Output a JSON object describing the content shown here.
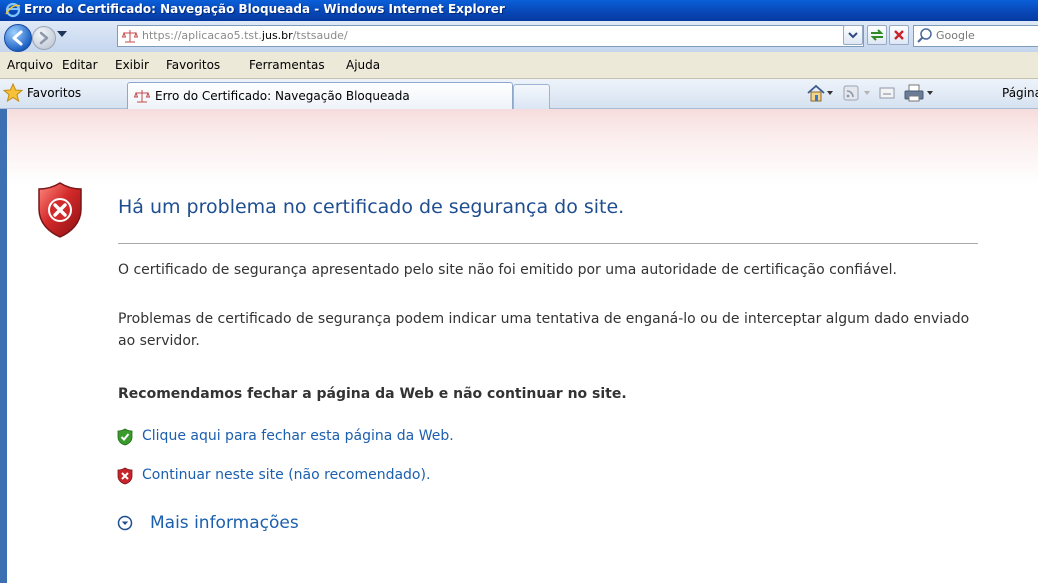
{
  "window": {
    "title": "Erro do Certificado: Navegação Bloqueada - Windows Internet Explorer"
  },
  "address_bar": {
    "url_prefix": "https://aplicacao5.tst.",
    "url_host": "jus.br",
    "url_suffix": "/tstsaude/",
    "search_placeholder": "Google"
  },
  "menu": {
    "items": [
      "Arquivo",
      "Editar",
      "Exibir",
      "Favoritos",
      "Ferramentas",
      "Ajuda"
    ]
  },
  "tabs": {
    "favorites_label": "Favoritos",
    "active_tab_label": "Erro do Certificado: Navegação Bloqueada",
    "page_menu_label": "Página"
  },
  "content": {
    "heading": "Há um problema no certificado de segurança do site.",
    "paragraph_1": "O certificado de segurança apresentado pelo site não foi emitido por uma autoridade de certificação confiável.",
    "paragraph_2": "Problemas de certificado de segurança podem indicar uma tentativa de enganá-lo ou de interceptar algum dado enviado ao servidor.",
    "recommendation": "Recomendamos fechar a página da Web e não continuar no site.",
    "close_link": "Clique aqui para fechar esta página da Web.",
    "continue_link": "Continuar neste site (não recomendado).",
    "more_info": "Mais informações"
  },
  "colors": {
    "heading": "#1f4e90",
    "link": "#1b5fae",
    "titlebar": "#0848b8",
    "shield_red": "#c8242b",
    "shield_green": "#3a9a2e"
  }
}
